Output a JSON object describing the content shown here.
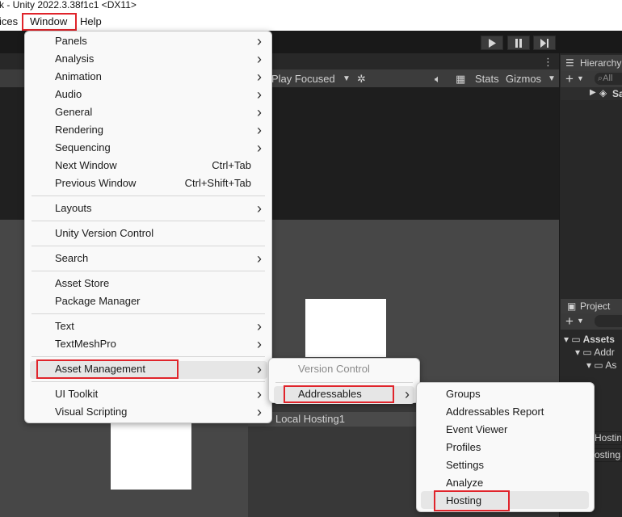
{
  "window_title": "k - Unity 2022.3.38f1c1 <DX11>",
  "menubar": {
    "services_label": "ices",
    "window_label": "Window",
    "help_label": "Help"
  },
  "editor": {
    "game_view": {
      "play_focused": "Play Focused",
      "stats": "Stats",
      "gizmos": "Gizmos"
    },
    "hierarchy_tab": "Hierarchy",
    "hierarchy_search_placeholder": "All",
    "hierarchy_root": "Sa",
    "project_tab": "Project",
    "project_tree": [
      "Assets",
      "Addr",
      "As"
    ],
    "hosting_row": "Local Hosting1",
    "right_fields": [
      "Hostin",
      "ostingS"
    ]
  },
  "window_menu": {
    "items": [
      {
        "label": "Panels",
        "submenu": true
      },
      {
        "label": "Analysis",
        "submenu": true
      },
      {
        "label": "Animation",
        "submenu": true
      },
      {
        "label": "Audio",
        "submenu": true
      },
      {
        "label": "General",
        "submenu": true
      },
      {
        "label": "Rendering",
        "submenu": true
      },
      {
        "label": "Sequencing",
        "submenu": true
      },
      {
        "label": "Next Window",
        "shortcut": "Ctrl+Tab"
      },
      {
        "label": "Previous Window",
        "shortcut": "Ctrl+Shift+Tab"
      },
      {
        "label": "Layouts",
        "submenu": true
      },
      {
        "label": "Unity Version Control"
      },
      {
        "label": "Search",
        "submenu": true
      },
      {
        "label": "Asset Store"
      },
      {
        "label": "Package Manager"
      },
      {
        "label": "Text",
        "submenu": true
      },
      {
        "label": "TextMeshPro",
        "submenu": true
      },
      {
        "label": "Asset Management",
        "submenu": true,
        "highlighted": true
      },
      {
        "label": "UI Toolkit",
        "submenu": true
      },
      {
        "label": "Visual Scripting",
        "submenu": true
      }
    ]
  },
  "asset_management_menu": {
    "items": [
      {
        "label": "Version Control",
        "disabled": true
      },
      {
        "label": "Addressables",
        "submenu": true,
        "highlighted": true
      }
    ]
  },
  "addressables_menu": {
    "items": [
      {
        "label": "Groups"
      },
      {
        "label": "Addressables Report"
      },
      {
        "label": "Event Viewer"
      },
      {
        "label": "Profiles"
      },
      {
        "label": "Settings"
      },
      {
        "label": "Analyze"
      },
      {
        "label": "Hosting",
        "highlighted": true
      }
    ]
  },
  "colors": {
    "highlight_box": "#e0242b",
    "menu_bg": "#f9f9f9",
    "editor_bg": "#1f1f1f"
  }
}
